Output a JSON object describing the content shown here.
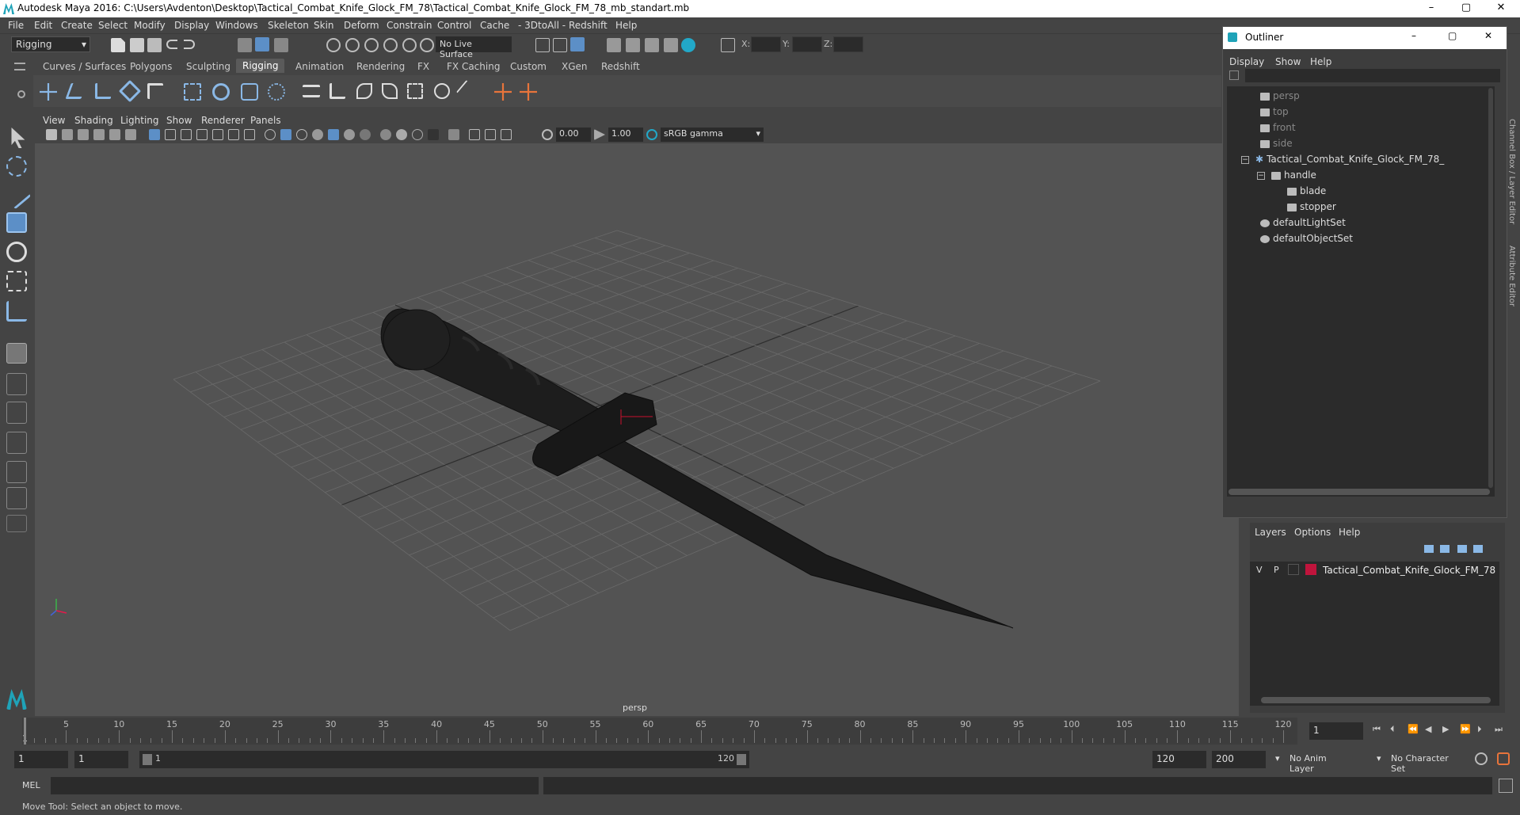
{
  "window": {
    "title": "Autodesk Maya 2016: C:\\Users\\Avdenton\\Desktop\\Tactical_Combat_Knife_Glock_FM_78\\Tactical_Combat_Knife_Glock_FM_78_mb_standart.mb"
  },
  "menubar": [
    "File",
    "Edit",
    "Create",
    "Select",
    "Modify",
    "Display",
    "Windows",
    "Skeleton",
    "Skin",
    "Deform",
    "Constrain",
    "Control",
    "Cache",
    "- 3DtoAll -",
    "Redshift",
    "Help"
  ],
  "statusline": {
    "mode": "Rigging",
    "live_surface": "No Live Surface",
    "x_label": "X:",
    "y_label": "Y:",
    "z_label": "Z:"
  },
  "shelf_tabs": [
    "Curves / Surfaces",
    "Polygons",
    "Sculpting",
    "Rigging",
    "Animation",
    "Rendering",
    "FX",
    "FX Caching",
    "Custom",
    "XGen",
    "Redshift"
  ],
  "viewport": {
    "menu": [
      "View",
      "Shading",
      "Lighting",
      "Show",
      "Renderer",
      "Panels"
    ],
    "exposure": "0.00",
    "gamma": "1.00",
    "color_space": "sRGB gamma",
    "camera_label": "persp"
  },
  "outliner": {
    "title": "Outliner",
    "menu": [
      "Display",
      "Show",
      "Help"
    ],
    "items": [
      {
        "label": "persp"
      },
      {
        "label": "top"
      },
      {
        "label": "front"
      },
      {
        "label": "side"
      },
      {
        "label": "Tactical_Combat_Knife_Glock_FM_78_"
      },
      {
        "label": "handle"
      },
      {
        "label": "blade"
      },
      {
        "label": "stopper"
      },
      {
        "label": "defaultLightSet"
      },
      {
        "label": "defaultObjectSet"
      }
    ]
  },
  "side_tabs": [
    "Channel Box / Layer Editor",
    "Attribute Editor"
  ],
  "layers": {
    "menu": [
      "Layers",
      "Options",
      "Help"
    ],
    "row": {
      "v": "V",
      "p": "P",
      "name": "Tactical_Combat_Knife_Glock_FM_78",
      "color": "#c0143c"
    }
  },
  "timeline": {
    "ticks": [
      "5",
      "10",
      "15",
      "20",
      "25",
      "30",
      "35",
      "40",
      "45",
      "50",
      "55",
      "60",
      "65",
      "70",
      "75",
      "80",
      "85",
      "90",
      "95",
      "100",
      "105",
      "110",
      "115",
      "120"
    ],
    "start_label": "1",
    "current_frame": "1"
  },
  "range": {
    "start": "1",
    "playback_start": "1",
    "slider_start": "1",
    "slider_end": "120",
    "playback_end": "120",
    "end": "200",
    "anim_layer": "No Anim Layer",
    "character_set": "No Character Set"
  },
  "cmdline": {
    "label": "MEL"
  },
  "helpline": {
    "text": "Move Tool: Select an object to move."
  }
}
